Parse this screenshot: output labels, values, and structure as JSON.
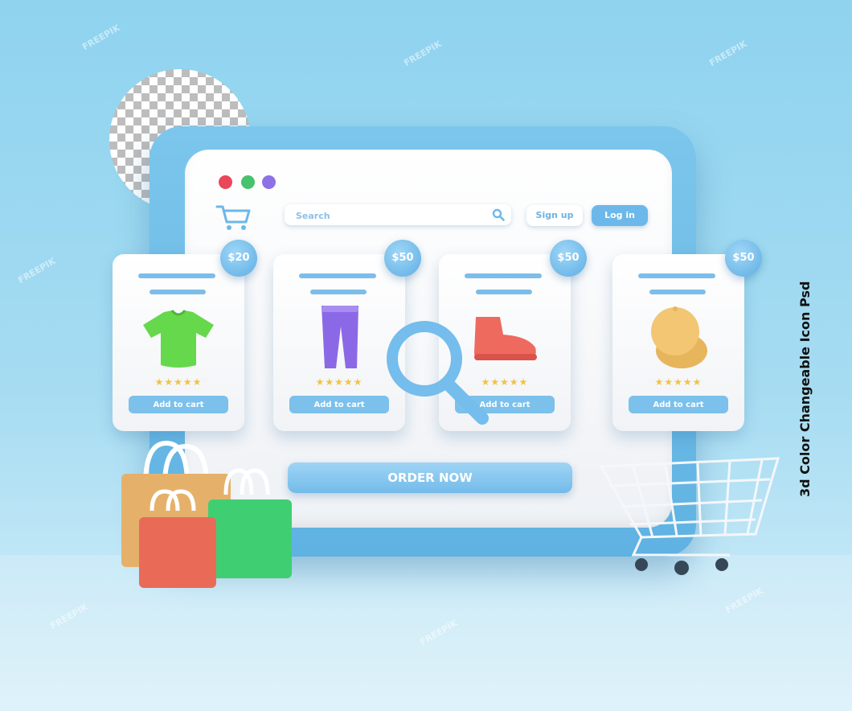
{
  "window": {
    "dot_colors": [
      "#e9475a",
      "#47c26d",
      "#8c72e6"
    ]
  },
  "header": {
    "search_placeholder": "Search",
    "signup_label": "Sign up",
    "login_label": "Log in"
  },
  "products": [
    {
      "price": "$20",
      "item": "t-shirt",
      "rating": 5,
      "add_label": "Add to cart",
      "color": "#66d84b"
    },
    {
      "price": "$50",
      "item": "pants",
      "rating": 5,
      "add_label": "Add to cart",
      "color": "#8b69e6"
    },
    {
      "price": "$50",
      "item": "shoe",
      "rating": 5,
      "add_label": "Add to cart",
      "color": "#ee6a5f"
    },
    {
      "price": "$50",
      "item": "cap",
      "rating": 5,
      "add_label": "Add to cart",
      "color": "#f2c673"
    }
  ],
  "order_label": "ORDER NOW",
  "side_caption": "3d Color Changeable Icon Psd",
  "watermark": "FREEPIK",
  "colors": {
    "accent": "#6cb8ea",
    "background": "#a6dcf2",
    "star": "#f4c23d"
  },
  "icons": [
    "cart-icon",
    "search-icon",
    "magnifier-icon",
    "shopping-bag-icon",
    "shopping-trolley-icon"
  ]
}
